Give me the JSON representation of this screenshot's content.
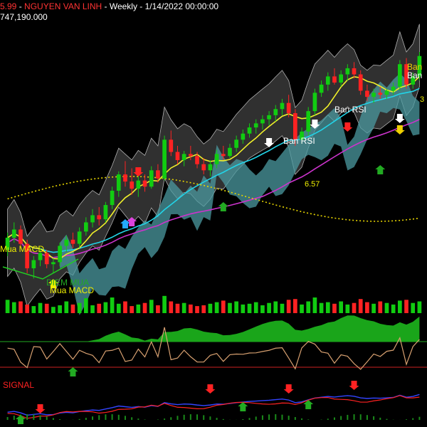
{
  "header": {
    "price": "5.99",
    "separator": " - ",
    "symbol": "NGUYEN VAN LINH",
    "interval": " - Weekly - ",
    "datetime": "1/14/2022 00:00:00",
    "volume": "747,190.000"
  },
  "colors": {
    "up": "#11cc11",
    "down": "#ff2222",
    "bb_fill": "#333333",
    "ema_fast": "#f0f02a",
    "ema_slow": "#22d4e8",
    "ma_long": "#cc33cc",
    "sar": "#e6d400",
    "cloud": "#8a8a8a",
    "cloud_teal": "#4b9aa0",
    "macd": "#3344ff",
    "signal": "#ff2222"
  },
  "labels": {
    "ban_rsi_1": "Ban RSI",
    "ban_rsi_2": "Ban RSI",
    "ban_top_1": "Ban",
    "ban_top_2": "Ban",
    "mua_macd_left": "Mua MACD",
    "mua_macd": "Mua MACD",
    "diem_mua": "DIEM MUA",
    "level_mid": "6.57",
    "level_top": "3",
    "signal_label": "SIGNAL"
  },
  "chart_data": {
    "type": "candlestick",
    "series_note": "",
    "candles": [
      [
        4.78,
        4.95,
        4.72,
        4.9
      ],
      [
        4.9,
        5.05,
        4.85,
        4.98
      ],
      [
        4.98,
        5.02,
        4.8,
        4.84
      ],
      [
        4.84,
        4.88,
        4.55,
        4.6
      ],
      [
        4.6,
        4.72,
        4.5,
        4.68
      ],
      [
        4.68,
        4.8,
        4.62,
        4.75
      ],
      [
        4.75,
        4.78,
        4.6,
        4.64
      ],
      [
        4.64,
        4.7,
        4.55,
        4.66
      ],
      [
        4.66,
        4.85,
        4.62,
        4.82
      ],
      [
        4.82,
        4.92,
        4.76,
        4.88
      ],
      [
        4.88,
        4.95,
        4.8,
        4.84
      ],
      [
        4.84,
        5.0,
        4.8,
        4.96
      ],
      [
        4.96,
        5.1,
        4.92,
        5.05
      ],
      [
        5.05,
        5.18,
        5.0,
        5.12
      ],
      [
        5.12,
        5.2,
        5.02,
        5.08
      ],
      [
        5.08,
        5.25,
        5.05,
        5.22
      ],
      [
        5.22,
        5.4,
        5.18,
        5.36
      ],
      [
        5.36,
        5.55,
        5.3,
        5.52
      ],
      [
        5.52,
        5.65,
        5.4,
        5.45
      ],
      [
        5.45,
        5.58,
        5.32,
        5.38
      ],
      [
        5.38,
        5.5,
        5.3,
        5.46
      ],
      [
        5.46,
        5.52,
        5.35,
        5.4
      ],
      [
        5.4,
        5.6,
        5.38,
        5.56
      ],
      [
        5.56,
        5.62,
        5.44,
        5.48
      ],
      [
        5.48,
        5.9,
        5.46,
        5.86
      ],
      [
        5.86,
        5.95,
        5.7,
        5.74
      ],
      [
        5.74,
        5.8,
        5.62,
        5.66
      ],
      [
        5.66,
        5.75,
        5.6,
        5.72
      ],
      [
        5.72,
        5.8,
        5.66,
        5.7
      ],
      [
        5.7,
        5.74,
        5.58,
        5.62
      ],
      [
        5.62,
        5.68,
        5.52,
        5.56
      ],
      [
        5.56,
        5.66,
        5.5,
        5.62
      ],
      [
        5.62,
        5.76,
        5.58,
        5.72
      ],
      [
        5.72,
        5.8,
        5.66,
        5.7
      ],
      [
        5.7,
        5.82,
        5.68,
        5.78
      ],
      [
        5.78,
        5.9,
        5.74,
        5.86
      ],
      [
        5.86,
        5.96,
        5.82,
        5.92
      ],
      [
        5.92,
        6.02,
        5.88,
        5.98
      ],
      [
        5.98,
        6.06,
        5.92,
        6.02
      ],
      [
        6.02,
        6.1,
        5.96,
        6.06
      ],
      [
        6.06,
        6.14,
        6.0,
        6.1
      ],
      [
        6.1,
        6.2,
        6.04,
        6.16
      ],
      [
        6.16,
        6.26,
        6.1,
        6.22
      ],
      [
        6.22,
        6.3,
        6.08,
        6.12
      ],
      [
        6.12,
        6.16,
        5.8,
        5.86
      ],
      [
        5.86,
        5.98,
        5.82,
        5.94
      ],
      [
        5.94,
        6.18,
        5.9,
        6.14
      ],
      [
        6.14,
        6.36,
        6.1,
        6.32
      ],
      [
        6.32,
        6.44,
        6.28,
        6.4
      ],
      [
        6.4,
        6.52,
        6.34,
        6.48
      ],
      [
        6.48,
        6.56,
        6.4,
        6.42
      ],
      [
        6.42,
        6.54,
        6.38,
        6.5
      ],
      [
        6.5,
        6.6,
        6.44,
        6.56
      ],
      [
        6.56,
        6.62,
        6.46,
        6.5
      ],
      [
        6.5,
        6.54,
        6.3,
        6.34
      ],
      [
        6.34,
        6.4,
        6.24,
        6.28
      ],
      [
        6.28,
        6.36,
        6.22,
        6.32
      ],
      [
        6.32,
        6.38,
        6.26,
        6.3
      ],
      [
        6.3,
        6.36,
        6.26,
        6.34
      ],
      [
        6.34,
        6.42,
        6.3,
        6.38
      ],
      [
        6.38,
        6.64,
        6.34,
        6.6
      ],
      [
        6.6,
        6.66,
        6.36,
        6.4
      ],
      [
        6.4,
        6.52,
        6.36,
        6.48
      ],
      [
        6.48,
        6.72,
        6.44,
        6.68
      ]
    ],
    "volume": [
      34,
      28,
      30,
      22,
      18,
      26,
      24,
      16,
      20,
      30,
      22,
      26,
      38,
      20,
      24,
      28,
      40,
      24,
      30,
      18,
      22,
      26,
      34,
      20,
      44,
      30,
      24,
      26,
      22,
      18,
      20,
      24,
      28,
      32,
      26,
      30,
      22,
      24,
      28,
      20,
      26,
      30,
      24,
      34,
      36,
      22,
      30,
      40,
      26,
      28,
      24,
      30,
      22,
      26,
      36,
      28,
      24,
      30,
      26,
      22,
      32,
      34,
      26,
      30
    ]
  }
}
